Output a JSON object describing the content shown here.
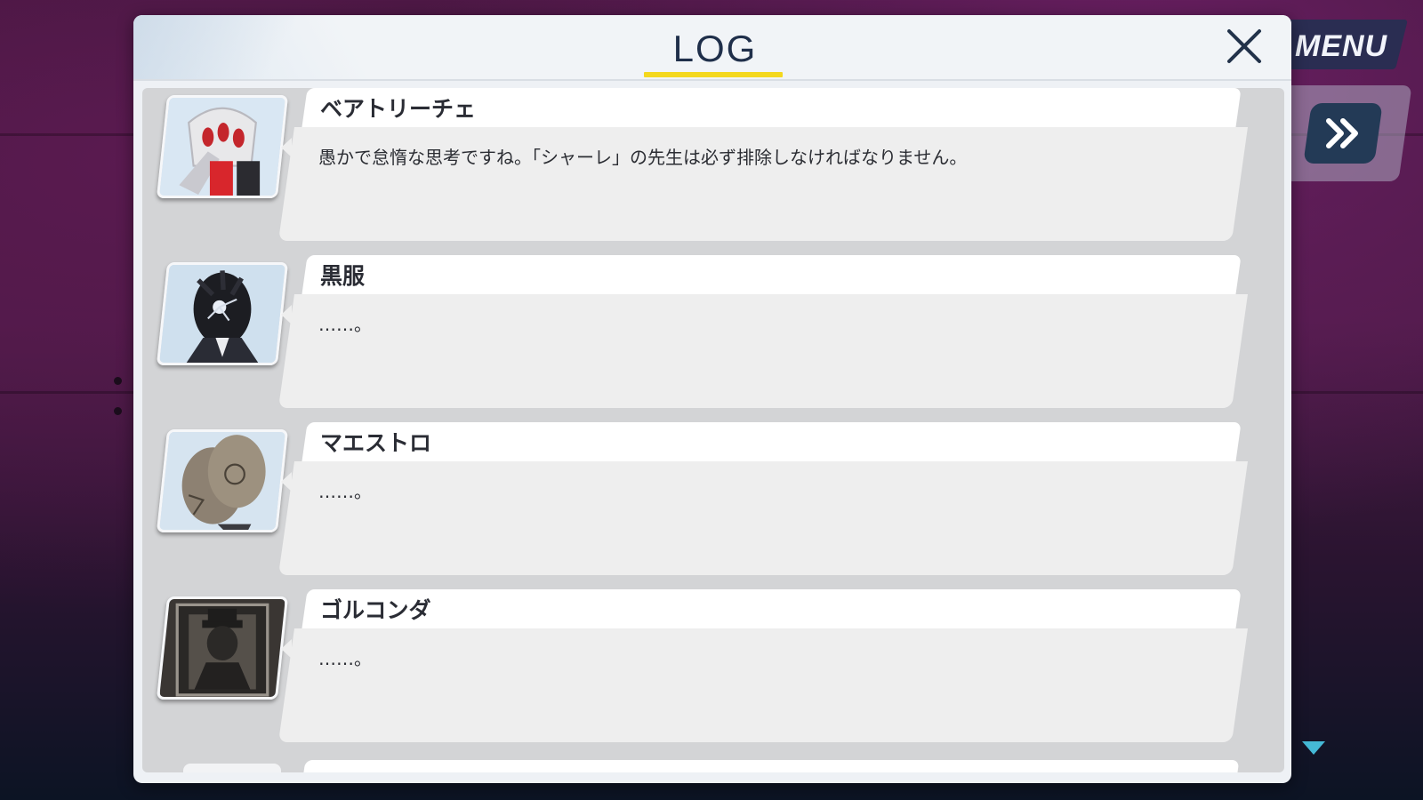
{
  "menu": {
    "label": "MENU"
  },
  "log": {
    "title": "LOG",
    "entries": [
      {
        "name": "ベアトリーチェ",
        "text": "愚かで怠惰な思考ですね。「シャーレ」の先生は必ず排除しなければなりません。",
        "portrait_icon": "beatrice-portrait"
      },
      {
        "name": "黒服",
        "text": "……。",
        "portrait_icon": "kurofuku-portrait"
      },
      {
        "name": "マエストロ",
        "text": "……。",
        "portrait_icon": "maestro-portrait"
      },
      {
        "name": "ゴルコンダ",
        "text": "……。",
        "portrait_icon": "golconda-portrait"
      }
    ]
  },
  "colors": {
    "title_underline": "#f4d81e",
    "menu_bg": "#2a2d52",
    "skip_bg": "#233a56",
    "scroll_arrow": "#45b9d6",
    "title_text": "#1f2f4a"
  }
}
